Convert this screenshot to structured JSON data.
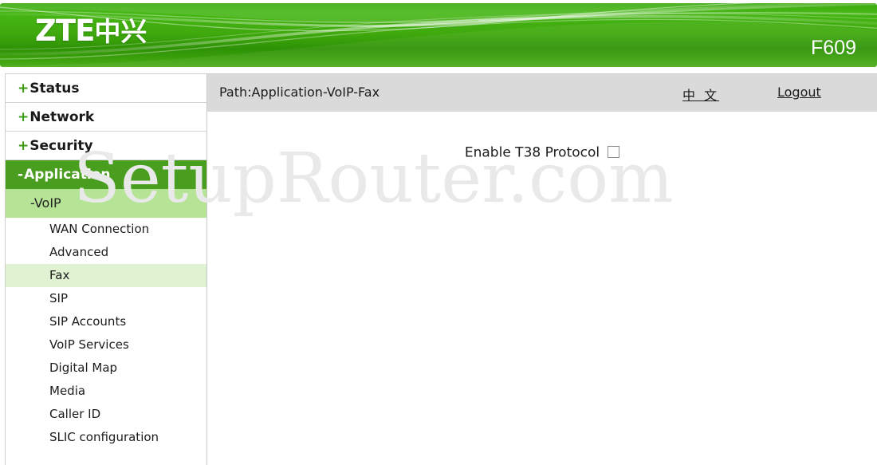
{
  "header": {
    "brand": "ZTE",
    "brand_cn": "中兴",
    "model": "F609",
    "banner_color": "#3fa80d"
  },
  "sidebar": {
    "top_items": [
      {
        "sign": "+",
        "label": "Status",
        "active": false
      },
      {
        "sign": "+",
        "label": "Network",
        "active": false
      },
      {
        "sign": "+",
        "label": "Security",
        "active": false
      },
      {
        "sign": "-",
        "label": "Application",
        "active": true
      }
    ],
    "sub_item": {
      "sign": "-",
      "label": "VoIP"
    },
    "leaf_items": [
      {
        "label": "WAN Connection",
        "selected": false
      },
      {
        "label": "Advanced",
        "selected": false
      },
      {
        "label": "Fax",
        "selected": true
      },
      {
        "label": "SIP",
        "selected": false
      },
      {
        "label": "SIP Accounts",
        "selected": false
      },
      {
        "label": "VoIP Services",
        "selected": false
      },
      {
        "label": "Digital Map",
        "selected": false
      },
      {
        "label": "Media",
        "selected": false
      },
      {
        "label": "Caller ID",
        "selected": false
      },
      {
        "label": "SLIC configuration",
        "selected": false
      }
    ],
    "active_color": "#4a9e1f",
    "sub_color": "#b6e496",
    "selected_color": "#e0f2d2"
  },
  "topbar": {
    "path": "Path:Application-VoIP-Fax",
    "language_link": "中 文",
    "logout_link": "Logout"
  },
  "content": {
    "t38_label": "Enable T38 Protocol",
    "t38_checked": false
  },
  "watermark": {
    "text": "SetupRouter.com"
  }
}
